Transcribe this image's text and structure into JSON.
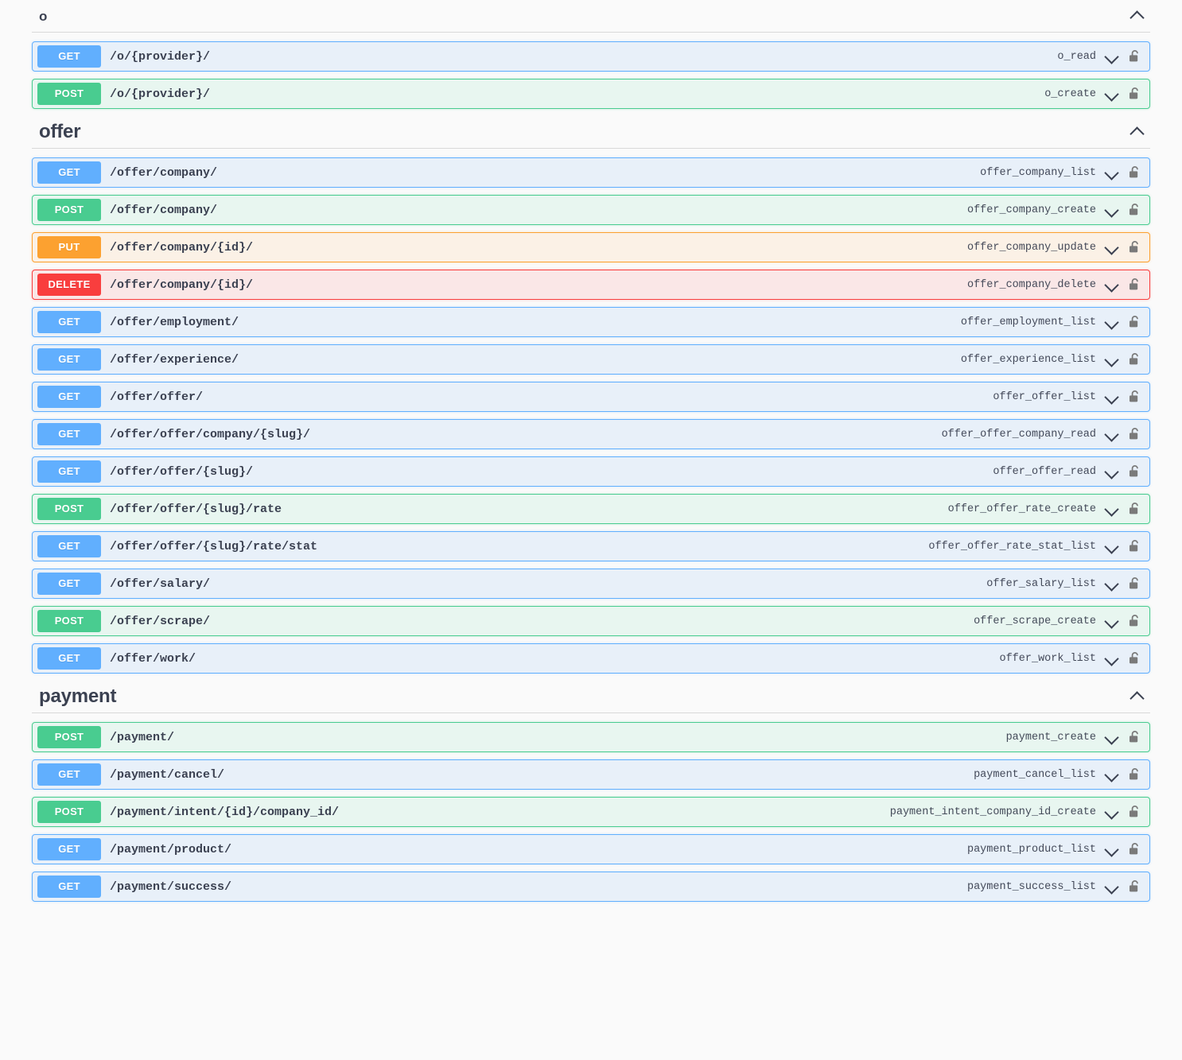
{
  "sections": [
    {
      "title": "o",
      "title_size": "small",
      "collapse_icon": "chevron-up-icon",
      "operations": [
        {
          "method": "GET",
          "method_key": "get",
          "path": "/o/{provider}/",
          "operation_id": "o_read",
          "expand_icon": "chevron-down-icon",
          "lock_icon": "unlocked-padlock-icon"
        },
        {
          "method": "POST",
          "method_key": "post",
          "path": "/o/{provider}/",
          "operation_id": "o_create",
          "expand_icon": "chevron-down-icon",
          "lock_icon": "unlocked-padlock-icon"
        }
      ]
    },
    {
      "title": "offer",
      "title_size": "large",
      "collapse_icon": "chevron-up-icon",
      "operations": [
        {
          "method": "GET",
          "method_key": "get",
          "path": "/offer/company/",
          "operation_id": "offer_company_list",
          "expand_icon": "chevron-down-icon",
          "lock_icon": "unlocked-padlock-icon"
        },
        {
          "method": "POST",
          "method_key": "post",
          "path": "/offer/company/",
          "operation_id": "offer_company_create",
          "expand_icon": "chevron-down-icon",
          "lock_icon": "unlocked-padlock-icon"
        },
        {
          "method": "PUT",
          "method_key": "put",
          "path": "/offer/company/{id}/",
          "operation_id": "offer_company_update",
          "expand_icon": "chevron-down-icon",
          "lock_icon": "unlocked-padlock-icon"
        },
        {
          "method": "DELETE",
          "method_key": "delete",
          "path": "/offer/company/{id}/",
          "operation_id": "offer_company_delete",
          "expand_icon": "chevron-down-icon",
          "lock_icon": "unlocked-padlock-icon"
        },
        {
          "method": "GET",
          "method_key": "get",
          "path": "/offer/employment/",
          "operation_id": "offer_employment_list",
          "expand_icon": "chevron-down-icon",
          "lock_icon": "unlocked-padlock-icon"
        },
        {
          "method": "GET",
          "method_key": "get",
          "path": "/offer/experience/",
          "operation_id": "offer_experience_list",
          "expand_icon": "chevron-down-icon",
          "lock_icon": "unlocked-padlock-icon"
        },
        {
          "method": "GET",
          "method_key": "get",
          "path": "/offer/offer/",
          "operation_id": "offer_offer_list",
          "expand_icon": "chevron-down-icon",
          "lock_icon": "unlocked-padlock-icon"
        },
        {
          "method": "GET",
          "method_key": "get",
          "path": "/offer/offer/company/{slug}/",
          "operation_id": "offer_offer_company_read",
          "expand_icon": "chevron-down-icon",
          "lock_icon": "unlocked-padlock-icon"
        },
        {
          "method": "GET",
          "method_key": "get",
          "path": "/offer/offer/{slug}/",
          "operation_id": "offer_offer_read",
          "expand_icon": "chevron-down-icon",
          "lock_icon": "unlocked-padlock-icon"
        },
        {
          "method": "POST",
          "method_key": "post",
          "path": "/offer/offer/{slug}/rate",
          "operation_id": "offer_offer_rate_create",
          "expand_icon": "chevron-down-icon",
          "lock_icon": "unlocked-padlock-icon"
        },
        {
          "method": "GET",
          "method_key": "get",
          "path": "/offer/offer/{slug}/rate/stat",
          "operation_id": "offer_offer_rate_stat_list",
          "expand_icon": "chevron-down-icon",
          "lock_icon": "unlocked-padlock-icon"
        },
        {
          "method": "GET",
          "method_key": "get",
          "path": "/offer/salary/",
          "operation_id": "offer_salary_list",
          "expand_icon": "chevron-down-icon",
          "lock_icon": "unlocked-padlock-icon"
        },
        {
          "method": "POST",
          "method_key": "post",
          "path": "/offer/scrape/",
          "operation_id": "offer_scrape_create",
          "expand_icon": "chevron-down-icon",
          "lock_icon": "unlocked-padlock-icon"
        },
        {
          "method": "GET",
          "method_key": "get",
          "path": "/offer/work/",
          "operation_id": "offer_work_list",
          "expand_icon": "chevron-down-icon",
          "lock_icon": "unlocked-padlock-icon"
        }
      ]
    },
    {
      "title": "payment",
      "title_size": "large",
      "collapse_icon": "chevron-up-icon",
      "operations": [
        {
          "method": "POST",
          "method_key": "post",
          "path": "/payment/",
          "operation_id": "payment_create",
          "expand_icon": "chevron-down-icon",
          "lock_icon": "unlocked-padlock-icon"
        },
        {
          "method": "GET",
          "method_key": "get",
          "path": "/payment/cancel/",
          "operation_id": "payment_cancel_list",
          "expand_icon": "chevron-down-icon",
          "lock_icon": "unlocked-padlock-icon"
        },
        {
          "method": "POST",
          "method_key": "post",
          "path": "/payment/intent/{id}/company_id/",
          "operation_id": "payment_intent_company_id_create",
          "expand_icon": "chevron-down-icon",
          "lock_icon": "unlocked-padlock-icon"
        },
        {
          "method": "GET",
          "method_key": "get",
          "path": "/payment/product/",
          "operation_id": "payment_product_list",
          "expand_icon": "chevron-down-icon",
          "lock_icon": "unlocked-padlock-icon"
        },
        {
          "method": "GET",
          "method_key": "get",
          "path": "/payment/success/",
          "operation_id": "payment_success_list",
          "expand_icon": "chevron-down-icon",
          "lock_icon": "unlocked-padlock-icon"
        }
      ]
    }
  ],
  "colors": {
    "get": "#61affe",
    "post": "#49cc90",
    "put": "#fca130",
    "delete": "#f93e3e",
    "text": "#3b4151",
    "background": "#fafafa"
  }
}
